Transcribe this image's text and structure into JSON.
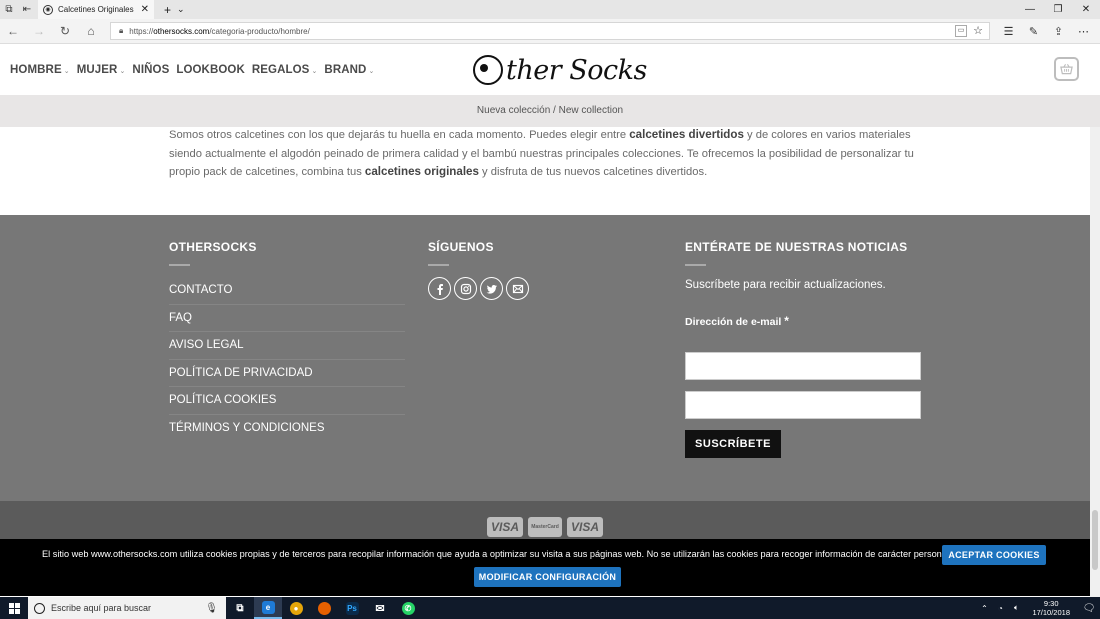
{
  "browser": {
    "tab_title": "Calcetines Originales Ho",
    "url_prefix": "https://",
    "url_host": "othersocks.com",
    "url_path": "/categoria-producto/hombre/"
  },
  "header": {
    "nav": [
      {
        "label": "HOMBRE",
        "dropdown": true
      },
      {
        "label": "MUJER",
        "dropdown": true
      },
      {
        "label": "NIÑOS",
        "dropdown": false
      },
      {
        "label": "LOOKBOOK",
        "dropdown": false
      },
      {
        "label": "REGALOS",
        "dropdown": true
      },
      {
        "label": "BRAND",
        "dropdown": true
      }
    ],
    "logo_text": "ther Socks",
    "promo": "Nueva colección / New collection"
  },
  "intro": {
    "p1": "Somos otros calcetines con los que dejarás tu huella en cada momento. Puedes elegir entre ",
    "b1": "calcetines divertidos",
    "p2": " y de colores en varios materiales siendo actualmente el algodón peinado de primera calidad y el bambú nuestras principales colecciones. Te ofrecemos la posibilidad de personalizar tu propio pack de calcetines, combina tus ",
    "b2": "calcetines originales",
    "p3": " y disfruta de tus nuevos calcetines divertidos."
  },
  "footer": {
    "col1_title": "OTHERSOCKS",
    "links": [
      "CONTACTO",
      "FAQ",
      "AVISO LEGAL",
      "POLÍTICA DE PRIVACIDAD",
      "POLÍTICA COOKIES",
      "TÉRMINOS Y CONDICIONES"
    ],
    "col2_title": "SÍGUENOS",
    "col3_title": "ENTÉRATE DE NUESTRAS NOTICIAS",
    "newsletter_text": "Suscríbete para recibir actualizaciones.",
    "email_label": "Dirección de e-mail",
    "required_mark": "*",
    "subscribe_label": "SUSCRÍBETE",
    "payments": [
      "VISA",
      "MasterCard",
      "VISA"
    ]
  },
  "cookie": {
    "text": "El sitio web www.othersocks.com utiliza cookies propias y de terceros para recopilar información que ayuda a optimizar su visita a sus páginas web. No se utilizarán las cookies para recoger información de carácter personal.",
    "accept_label": "ACEPTAR COOKIES",
    "config_label": "MODIFICAR CONFIGURACIÓN"
  },
  "taskbar": {
    "search_placeholder": "Escribe aquí para buscar",
    "time": "9:30",
    "date": "17/10/2018"
  }
}
